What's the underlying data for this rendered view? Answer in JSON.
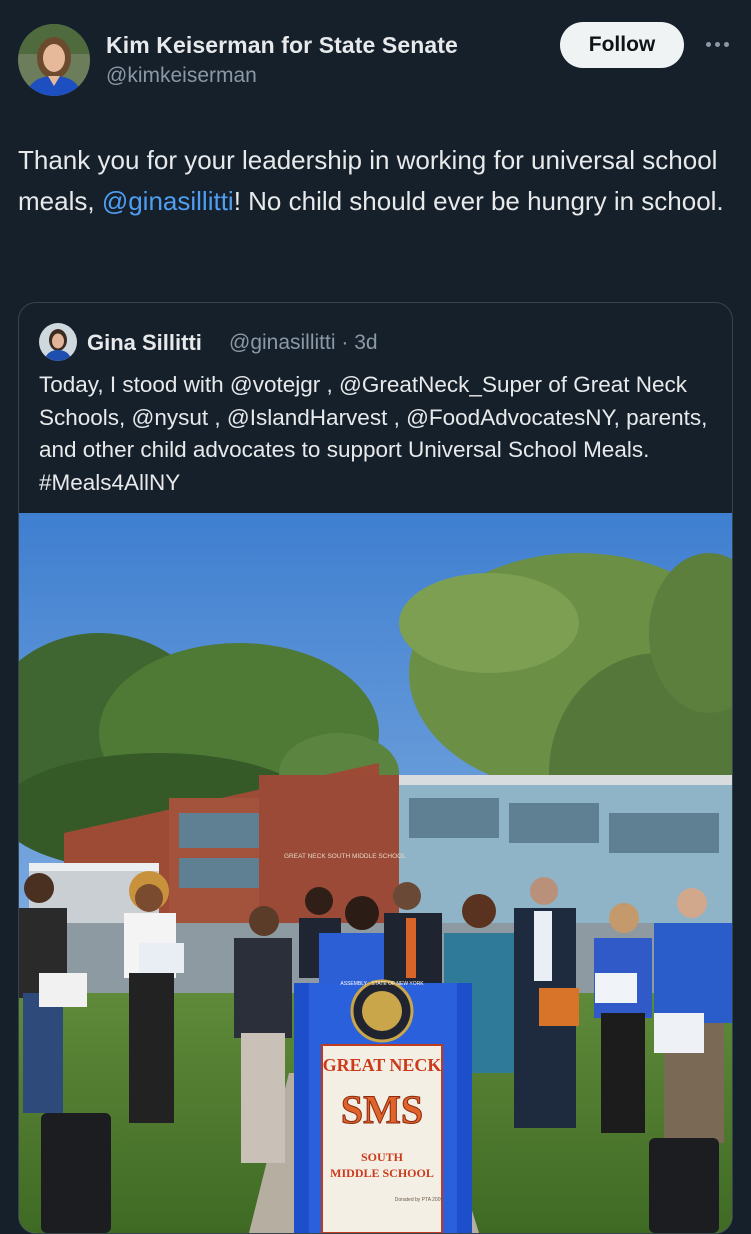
{
  "author": {
    "display_name": "Kim Keiserman for State Senate",
    "handle": "@kimkeiserman"
  },
  "actions": {
    "follow_label": "Follow",
    "more_icon": "more-horizontal-icon"
  },
  "tweet": {
    "text_before": "Thank you for your leadership in working for universal school meals, ",
    "mention": "@ginasillitti",
    "text_after": "! No child should ever be hungry in school."
  },
  "quoted_tweet": {
    "display_name": "Gina Sillitti",
    "handle": "@ginasillitti",
    "separator": "·",
    "time": "3d",
    "text": "Today, I stood with @votejgr , @GreatNeck_Super of Great Neck Schools, @nysut , @IslandHarvest , @FoodAdvocatesNY, parents, and other child advocates to support Universal School Meals. #Meals4AllNY"
  },
  "photo": {
    "podium_sign_line1": "GREAT NECK",
    "podium_sign_logo": "SMS",
    "podium_sign_line2": "SOUTH",
    "podium_sign_line3": "MIDDLE SCHOOL",
    "podium_seal": "ASSEMBLY · STATE OF NEW YORK",
    "podium_donor": "Donated by PTA 2009",
    "building_sign": "GREAT NECK SOUTH MIDDLE SCHOOL"
  },
  "colors": {
    "background": "#15202b",
    "text": "#e7e9ea",
    "muted": "#8b98a5",
    "link": "#4f9ef2",
    "border": "#38444d"
  }
}
